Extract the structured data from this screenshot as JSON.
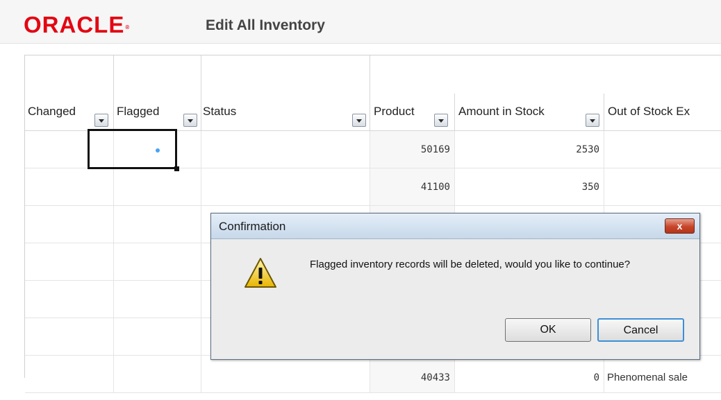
{
  "header": {
    "logo_text": "ORACLE",
    "logo_mark": "®",
    "title": "Edit All Inventory"
  },
  "columns": [
    {
      "label": "Changed"
    },
    {
      "label": "Flagged"
    },
    {
      "label": "Status"
    },
    {
      "label": "Product"
    },
    {
      "label": "Amount in Stock"
    },
    {
      "label": "Out of Stock Ex"
    }
  ],
  "rows": [
    {
      "flagged": true,
      "product": "50169",
      "amount": "2530",
      "note": ""
    },
    {
      "flagged": false,
      "product": "41100",
      "amount": "350",
      "note": ""
    },
    {
      "flagged": false,
      "product": "",
      "amount": "",
      "note": ""
    },
    {
      "flagged": false,
      "product": "",
      "amount": "",
      "note": ""
    },
    {
      "flagged": false,
      "product": "",
      "amount": "",
      "note": ""
    },
    {
      "flagged": false,
      "product": "",
      "amount": "",
      "note": ""
    },
    {
      "flagged": false,
      "product": "40433",
      "amount": "0",
      "note": "Phenomenal sale"
    }
  ],
  "dialog": {
    "title": "Confirmation",
    "close_label": "x",
    "icon": "warning-icon",
    "message": "Flagged inventory records will be deleted, would you like to continue?",
    "ok_label": "OK",
    "cancel_label": "Cancel"
  },
  "colors": {
    "brand": "#e30613",
    "selection": "#4aa3f0",
    "focus_border": "#3c8fd6"
  }
}
